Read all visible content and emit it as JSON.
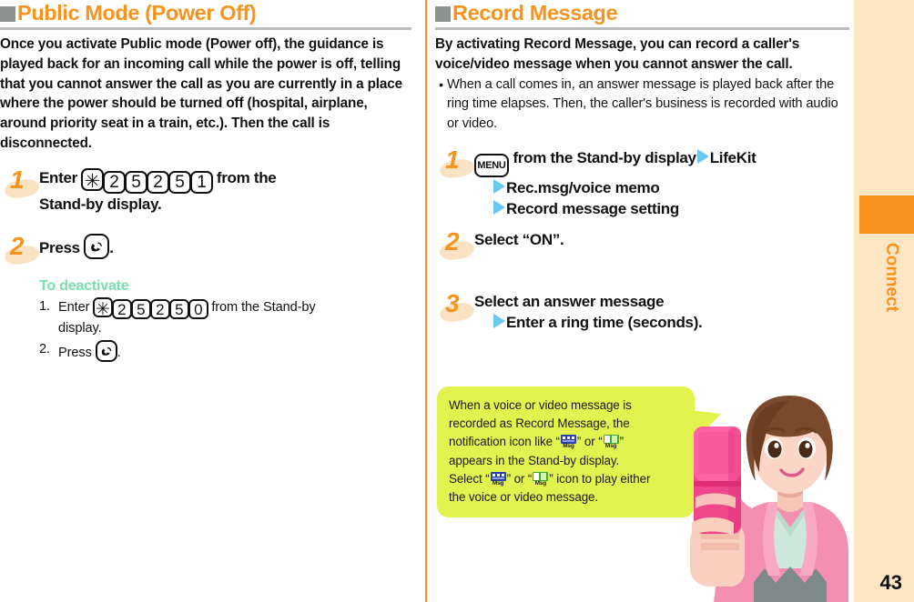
{
  "left_section": {
    "header": {
      "marker": "gray-square",
      "title": "Public Mode (Power Off)"
    },
    "intro": "Once you activate Public mode (Power off), the guidance is played back for an incoming call while the power is off, telling that you cannot answer the call as you are currently in a place where the power should be turned off (hospital, airplane, around priority seat in a train, etc.). Then the call is disconnected.",
    "steps": [
      {
        "number": "1",
        "line1_pre": "Enter",
        "keys": [
          "✳",
          "2",
          "5",
          "2",
          "5",
          "1"
        ],
        "line1_post": "from the",
        "line2": "Stand-by display."
      },
      {
        "number": "2",
        "line1_pre": "Press",
        "key": "call-key",
        "line1_post": "."
      }
    ],
    "deactivate": {
      "title": "To deactivate",
      "items": [
        {
          "marker": "1.",
          "pre": "Enter",
          "keys": [
            "✳",
            "2",
            "5",
            "2",
            "5",
            "0"
          ],
          "post": "from the Stand-by",
          "second_line": "display."
        },
        {
          "marker": "2.",
          "pre": "Press",
          "key": "call-key",
          "post": "."
        }
      ]
    }
  },
  "right_section": {
    "header": {
      "marker": "gray-square",
      "title": "Record Message"
    },
    "intro": "By activating Record Message, you can record a caller's voice/video message when you cannot answer the call.",
    "bullet": "When a call comes in, an answer message is played back after the ring time elapses. Then, the caller's business is recorded with audio or video.",
    "steps": [
      {
        "number": "1",
        "key": "menu-key",
        "line1_pre": "from the Stand-by display",
        "line1_post": "LifeKit",
        "line2": "Rec.msg/voice memo",
        "line3": "Record message setting"
      },
      {
        "number": "2",
        "line1": "Select “ON”."
      },
      {
        "number": "3",
        "line1": "Select an answer message",
        "line2": "Enter a ring time (seconds)."
      }
    ],
    "callout": {
      "lines": [
        {
          "text": "When a voice or video message is"
        },
        {
          "text": "recorded as Record Message, the"
        },
        {
          "pre": "notification icon like “",
          "icon1": "voice-msg-icon",
          "mid": "” or “",
          "icon2": "video-msg-icon",
          "post": "”"
        },
        {
          "text": "appears in the Stand-by display."
        },
        {
          "pre": "Select “",
          "icon1": "voice-msg-icon",
          "mid": "” or “",
          "icon2": "video-msg-icon",
          "post": "” icon to play either"
        },
        {
          "text": "the voice or video message."
        }
      ]
    }
  },
  "sidebar": {
    "tab_label": "Connect",
    "page_number": "43"
  },
  "colors": {
    "accent_orange": "#f7941e",
    "header_square_gray": "#8e9291",
    "header_rule_gray": "#b9bdbd",
    "deactivate_green": "#7ae0ae",
    "triangle_blue": "#69c8ef",
    "callout_yellow": "#e2f24f",
    "sidebar_cream": "#fce6c4",
    "step_blob_peach": "#fae3c2"
  },
  "illustration": {
    "name": "woman-holding-mobile-phone",
    "phone_color": "#f0468c",
    "jacket_color": "#f48fb1",
    "hair_color": "#7b4a2d"
  }
}
